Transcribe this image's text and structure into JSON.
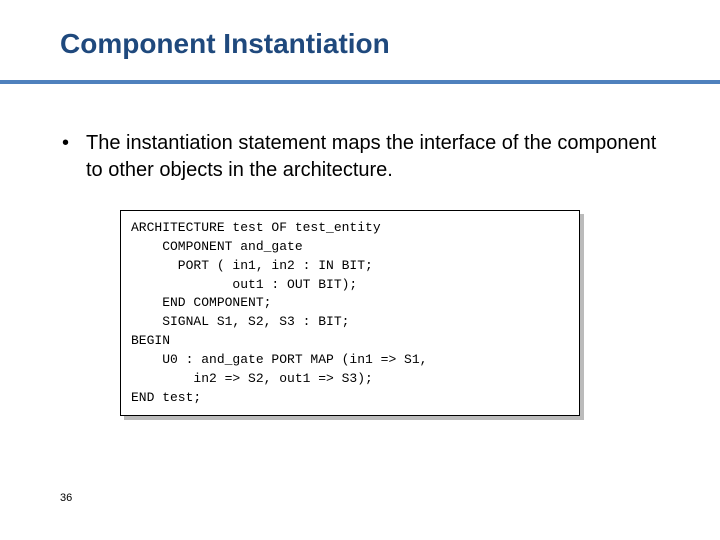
{
  "title": "Component Instantiation",
  "bullet": {
    "marker": "•",
    "text": "The instantiation statement maps the interface of the component to other objects in the architecture."
  },
  "code": {
    "l1": "ARCHITECTURE test OF test_entity",
    "l2": "    COMPONENT and_gate",
    "l3": "      PORT ( in1, in2 : IN BIT;",
    "l4": "             out1 : OUT BIT);",
    "l5": "    END COMPONENT;",
    "l6": "    SIGNAL S1, S2, S3 : BIT;",
    "l7": "BEGIN",
    "l8": "    U0 : and_gate PORT MAP (in1 => S1,",
    "l9": "        in2 => S2, out1 => S3);",
    "l10": "END test;"
  },
  "page_number": "36"
}
